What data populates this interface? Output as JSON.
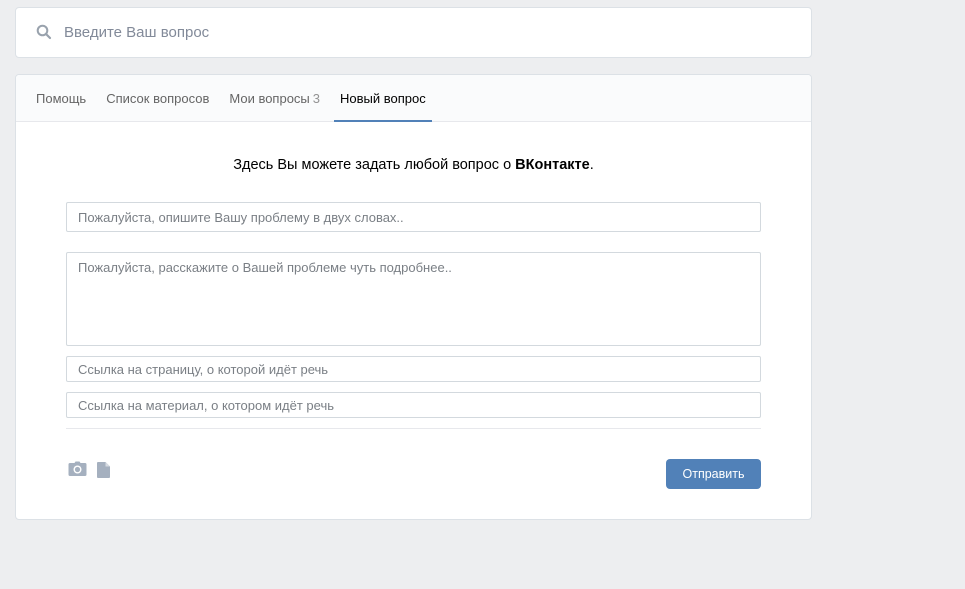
{
  "search": {
    "placeholder": "Введите Ваш вопрос"
  },
  "tabs": [
    {
      "label": "Помощь",
      "count": ""
    },
    {
      "label": "Список вопросов",
      "count": ""
    },
    {
      "label": "Мои вопросы",
      "count": "3"
    },
    {
      "label": "Новый вопрос",
      "count": "",
      "active": true
    }
  ],
  "form": {
    "intro_prefix": "Здесь Вы можете задать любой вопрос о ",
    "intro_brand": "ВКонтакте",
    "intro_suffix": ".",
    "title_placeholder": "Пожалуйста, опишите Вашу проблему в двух словах..",
    "details_placeholder": "Пожалуйста, расскажите о Вашей проблеме чуть подробнее..",
    "page_link_placeholder": "Ссылка на страницу, о которой идёт речь",
    "material_link_placeholder": "Ссылка на материал, о котором идёт речь",
    "submit_label": "Отправить"
  },
  "icons": {
    "search": "search-icon",
    "camera": "camera-icon",
    "document": "document-icon"
  },
  "colors": {
    "accent": "#5181b8",
    "background": "#edeef0",
    "icon": "#a5b0bf"
  }
}
